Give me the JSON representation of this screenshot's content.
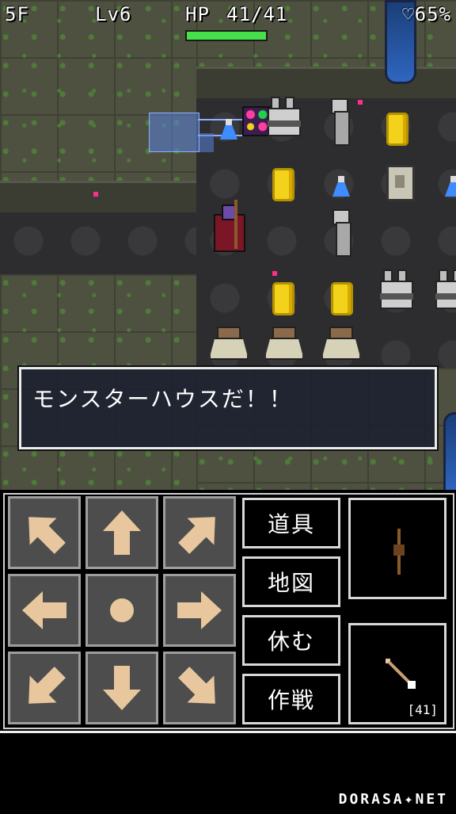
{
  "hud": {
    "floor": "5F",
    "level": "Lv6",
    "hp_label": "HP",
    "hp_value": "41/41",
    "hp_fraction": 1.0,
    "satiety": "♡65%",
    "colors": {
      "hp_bar": "#46e04a"
    }
  },
  "message": "モンスターハウスだ！！",
  "dpad": [
    {
      "icon": "arrow-up-left-icon",
      "dir": "up-left"
    },
    {
      "icon": "arrow-up-icon",
      "dir": "up"
    },
    {
      "icon": "arrow-up-right-icon",
      "dir": "up-right"
    },
    {
      "icon": "arrow-left-icon",
      "dir": "left"
    },
    {
      "icon": "wait-dot-icon",
      "dir": "center"
    },
    {
      "icon": "arrow-right-icon",
      "dir": "right"
    },
    {
      "icon": "arrow-down-left-icon",
      "dir": "down-left"
    },
    {
      "icon": "arrow-down-icon",
      "dir": "down"
    },
    {
      "icon": "arrow-down-right-icon",
      "dir": "down-right"
    }
  ],
  "commands": {
    "items": "道具",
    "map": "地図",
    "rest": "休む",
    "tactics": "作戦"
  },
  "equipment": {
    "weapon_icon": "staff-icon",
    "ammo_icon": "arrow-icon",
    "ammo_count": "[41]"
  },
  "brand": "DORASA✦NET",
  "colors": {
    "arrow_fill": "#e8c79e",
    "button_bg": "#4d4d4d"
  }
}
